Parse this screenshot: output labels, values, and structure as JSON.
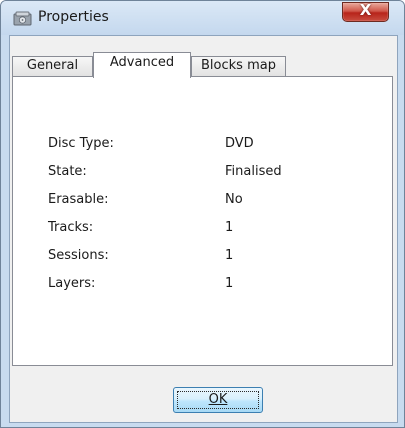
{
  "window": {
    "title": "Properties",
    "close_symbol": "X"
  },
  "tabs": [
    {
      "label": "General",
      "active": false
    },
    {
      "label": "Advanced",
      "active": true
    },
    {
      "label": "Blocks map",
      "active": false
    }
  ],
  "properties": [
    {
      "label": "Disc Type:",
      "value": "DVD"
    },
    {
      "label": "State:",
      "value": "Finalised"
    },
    {
      "label": "Erasable:",
      "value": "No"
    },
    {
      "label": "Tracks:",
      "value": "1"
    },
    {
      "label": "Sessions:",
      "value": "1"
    },
    {
      "label": "Layers:",
      "value": "1"
    }
  ],
  "buttons": {
    "ok_label": "OK"
  },
  "icons": {
    "app": "disc-drive-icon",
    "close": "close-icon"
  },
  "colors": {
    "title_bar": "#c8dbef",
    "close_button": "#c8453a",
    "ok_button": "#bee6fd"
  }
}
